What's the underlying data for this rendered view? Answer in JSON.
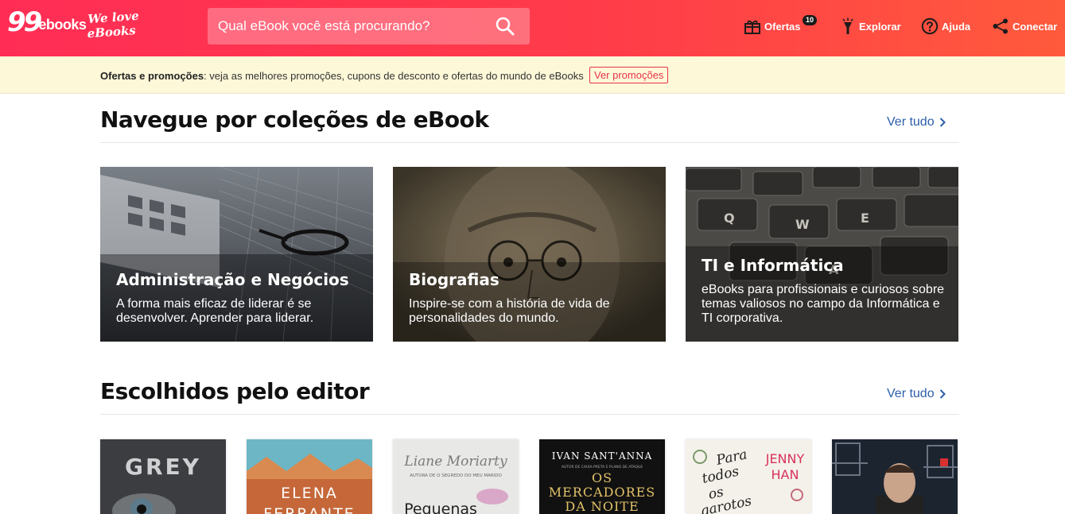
{
  "header": {
    "logo_number": "99",
    "logo_word": "ebooks",
    "tagline_line1": "We love",
    "tagline_line2": "eBooks",
    "search_placeholder": "Qual eBook você está procurando?",
    "nav": {
      "offers": "Ofertas",
      "offers_badge": "10",
      "explore": "Explorar",
      "help": "Ajuda",
      "connect": "Conectar"
    }
  },
  "promo": {
    "label": "Ofertas e promoções",
    "text": ": veja as melhores promoções, cupons de desconto e ofertas do mundo de eBooks",
    "link": "Ver promoções"
  },
  "collections": {
    "title": "Navegue por coleções de eBook",
    "see_all": "Ver tudo",
    "cards": [
      {
        "title": "Administração e Negócios",
        "desc": "A forma mais eficaz de liderar é se desenvolver. Aprender para liderar."
      },
      {
        "title": "Biografias",
        "desc": "Inspire-se com a história de vida de personalidades do mundo."
      },
      {
        "title": "TI e Informática",
        "desc": "eBooks para profissionais e curiosos sobre temas valiosos no campo da Informática e TI corporativa."
      }
    ]
  },
  "editor": {
    "title": "Escolhidos pelo editor",
    "see_all": "Ver tudo",
    "books": [
      {
        "text1": "GREY"
      },
      {
        "text1": "ELENA",
        "text2": "FERRANTE"
      },
      {
        "text1": "Liane Moriarty",
        "text2": "AUTORA DE O SEGREDO DO MEU MARIDO",
        "text3": "Pequenas"
      },
      {
        "text1": "IVAN SANT'ANNA",
        "text2": "AUTOR DE CAIXA-PRETA E PLANO DE ATAQUE",
        "text3": "OS",
        "text4": "MERCADORES",
        "text5": "DA NOITE"
      },
      {
        "text1": "Para",
        "text2": "todos",
        "text3": "os",
        "text4": "garotos",
        "text5": "JENNY",
        "text6": "HAN"
      },
      {
        "text1": ""
      }
    ]
  }
}
